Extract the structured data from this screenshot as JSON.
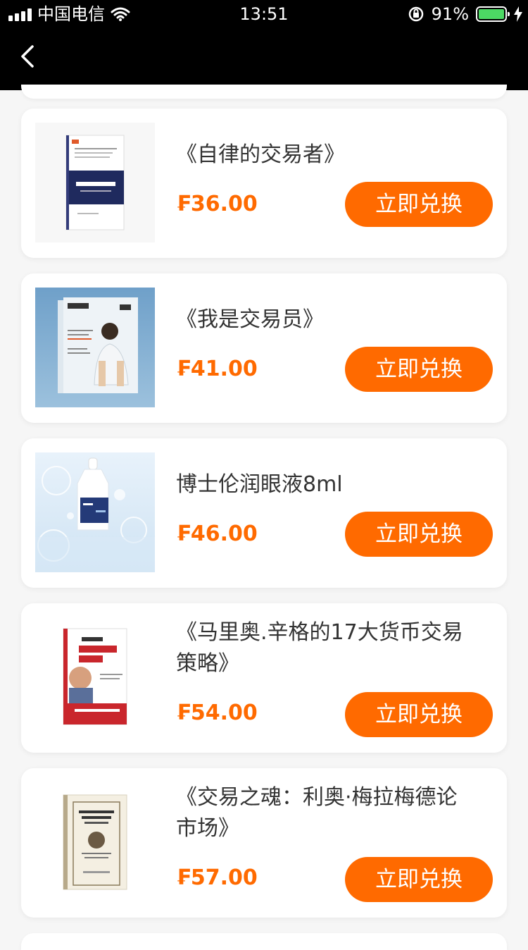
{
  "status_bar": {
    "carrier": "中国电信",
    "time": "13:51",
    "battery_percent": "91%",
    "battery_level": 0.91
  },
  "nav": {
    "back_icon": "chevron-left-icon"
  },
  "colors": {
    "accent": "#ff6a00",
    "header_bg": "#000000",
    "page_bg": "#f6f6f6"
  },
  "items": [
    {
      "title": "《自律的交易者》",
      "price": "₣36.00",
      "button": "立即兑换",
      "image": "book-cover-disciplined-trader"
    },
    {
      "title": "《我是交易员》",
      "price": "₣41.00",
      "button": "立即兑换",
      "image": "book-cover-i-am-trader"
    },
    {
      "title": "博士伦润眼液8ml",
      "price": "₣46.00",
      "button": "立即兑换",
      "image": "eye-drops-bottle"
    },
    {
      "title": "《马里奥.辛格的17大货币交易策略》",
      "price": "₣54.00",
      "button": "立即兑换",
      "image": "book-cover-forex"
    },
    {
      "title": "《交易之魂：利奥·梅拉梅德论市场》",
      "price": "₣57.00",
      "button": "立即兑换",
      "image": "book-cover-trading-soul"
    }
  ]
}
